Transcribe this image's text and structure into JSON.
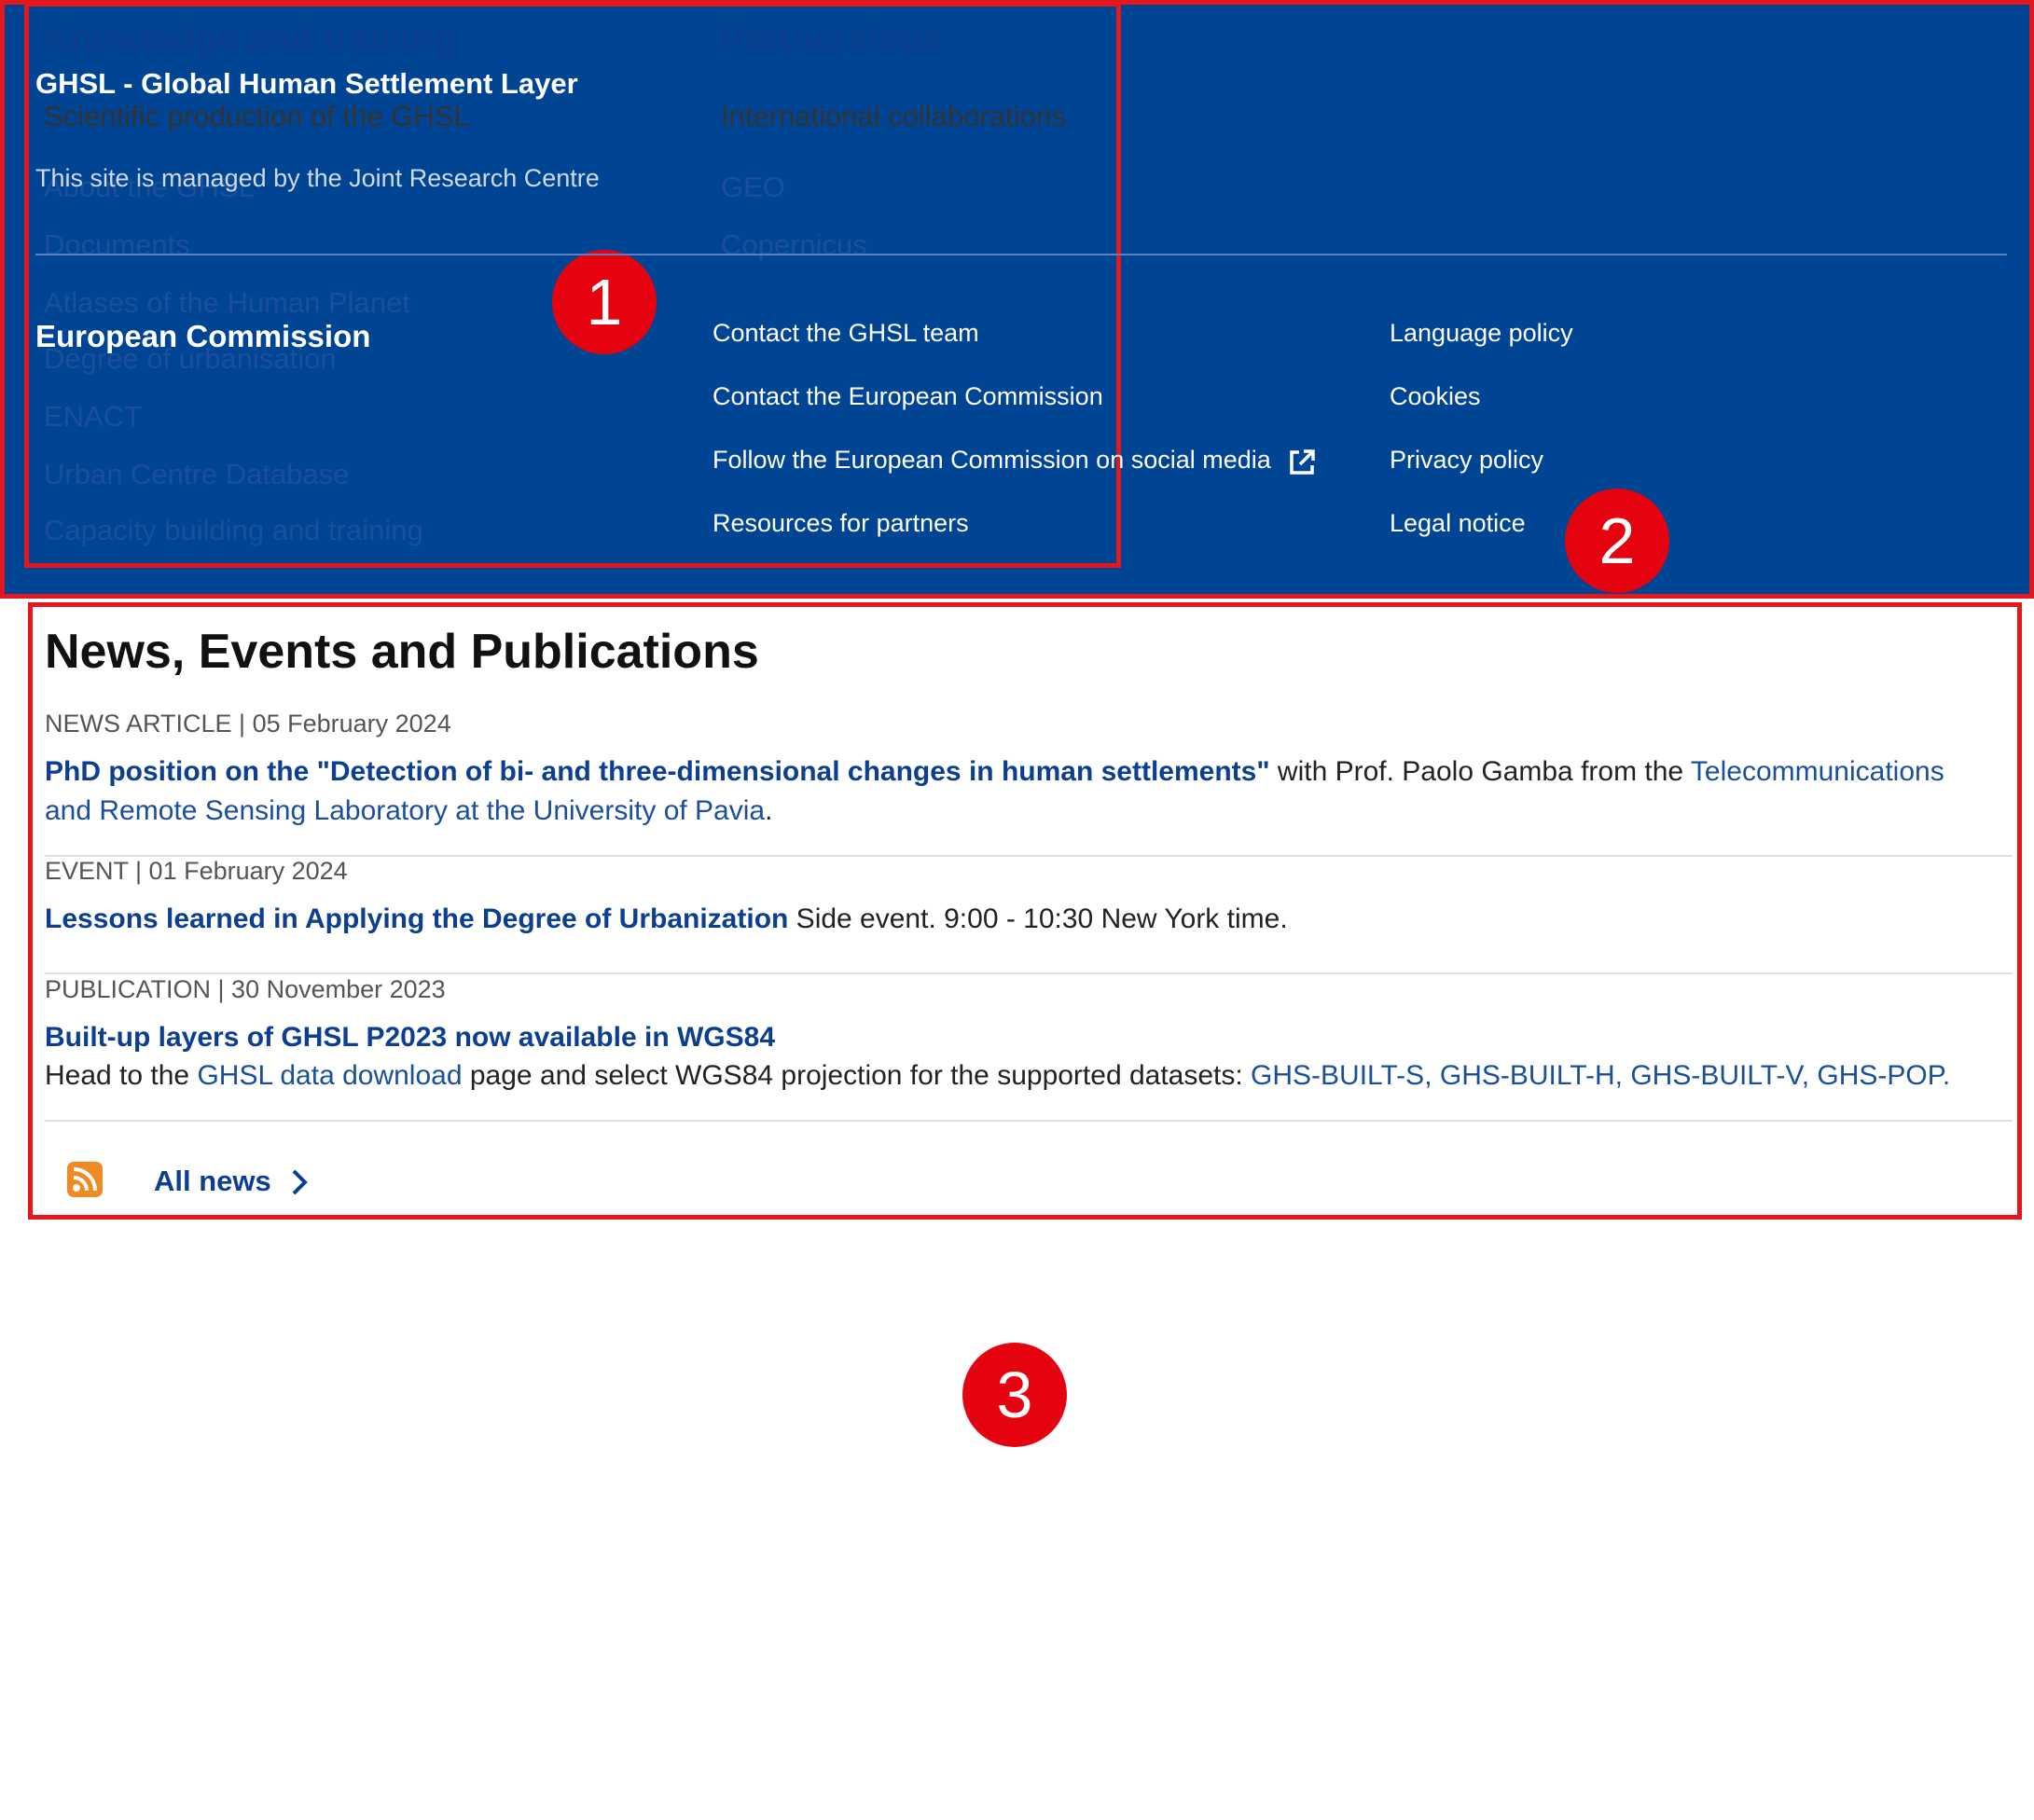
{
  "knowledge": {
    "title": "Knowledge and training",
    "subtitle": "Scientific production of the GHSL",
    "links": [
      "About the GHSL",
      "Documents",
      "Atlases of the Human Planet",
      "Degree of urbanisation",
      "ENACT",
      "Urban Centre Database",
      "Capacity building and training"
    ]
  },
  "partnerships": {
    "title": "Partnerships",
    "subtitle": "International collaborations",
    "links": [
      "GEO",
      "Copernicus"
    ]
  },
  "badges": [
    "1",
    "2",
    "3"
  ],
  "news": {
    "heading": "News, Events and Publications",
    "items": [
      {
        "meta": "NEWS ARTICLE | 05 February 2024",
        "title": "PhD position on the \"Detection of bi- and three-dimensional changes in human settlements\"",
        "text1": " with Prof. Paolo Gamba from the ",
        "link1": "Telecommunications",
        "link1b": "and Remote Sensing Laboratory at the University of Pavia",
        "text1b": "."
      },
      {
        "meta": "EVENT | 01 February 2024",
        "title": "Lessons learned in Applying the Degree of Urbanization",
        "text": " Side event. 9:00 - 10:30 New York time."
      },
      {
        "meta": "PUBLICATION | 30 November 2023",
        "title": "Built-up layers of GHSL P2023 now available in WGS84",
        "text_a": "Head to the ",
        "link_a": "GHSL data download",
        "text_b": " page and select WGS84 projection for the supported datasets: ",
        "link_b": "GHS-BUILT-S",
        "link_c": "GHS-BUILT-H",
        "link_d": "GHS-BUILT-V",
        "link_e": "GHS-POP",
        "comma": ", ",
        "end": "."
      }
    ],
    "all_news": "All news",
    "rss_icon": "rss-icon",
    "chevron_icon": "chevron-right-icon"
  },
  "footer": {
    "title": "GHSL - Global Human Settlement Layer",
    "managed": "This site is managed by the Joint Research Centre",
    "ec": "European Commission",
    "col2": [
      "Contact the GHSL team",
      "Contact the European Commission",
      "Follow the European Commission on social media",
      "Resources for partners"
    ],
    "col3": [
      "Language policy",
      "Cookies",
      "Privacy policy",
      "Legal notice"
    ],
    "external_icon": "external-link-icon"
  },
  "colors": {
    "annotation_red": "#e4171c",
    "link_blue": "#1a4f9c",
    "footer_blue": "#004494"
  }
}
